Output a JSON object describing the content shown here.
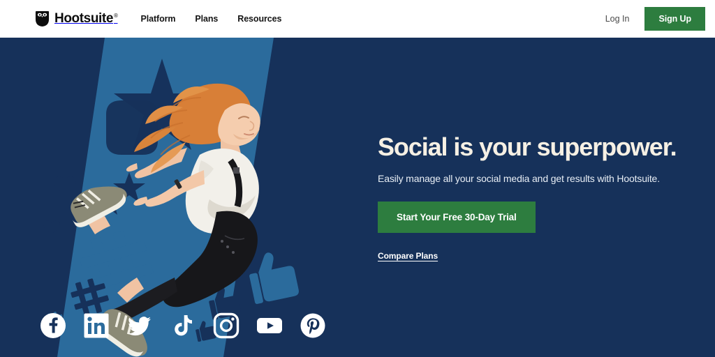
{
  "brand": {
    "name": "Hootsuite",
    "registered_mark": "®",
    "logo_icon": "owl-icon",
    "accent_green": "#2d7d3f",
    "navy": "#16315a",
    "stripe_blue": "#2b6b9c",
    "cream": "#f6f0e4"
  },
  "header": {
    "nav": [
      {
        "label": "Platform"
      },
      {
        "label": "Plans"
      },
      {
        "label": "Resources"
      }
    ],
    "login_label": "Log In",
    "signup_label": "Sign Up"
  },
  "hero": {
    "headline": "Social is your superpower.",
    "subhead": "Easily manage all your social media and get results with Hootsuite.",
    "cta_label": "Start Your Free 30-Day Trial",
    "secondary_link_label": "Compare Plans",
    "image_alt": "Woman with red hair jumping in white t-shirt and black overalls"
  },
  "social_links": [
    {
      "name": "facebook",
      "icon": "facebook-icon"
    },
    {
      "name": "linkedin",
      "icon": "linkedin-icon"
    },
    {
      "name": "twitter",
      "icon": "twitter-icon"
    },
    {
      "name": "tiktok",
      "icon": "tiktok-icon"
    },
    {
      "name": "instagram",
      "icon": "instagram-icon"
    },
    {
      "name": "youtube",
      "icon": "youtube-icon"
    },
    {
      "name": "pinterest",
      "icon": "pinterest-icon"
    }
  ]
}
